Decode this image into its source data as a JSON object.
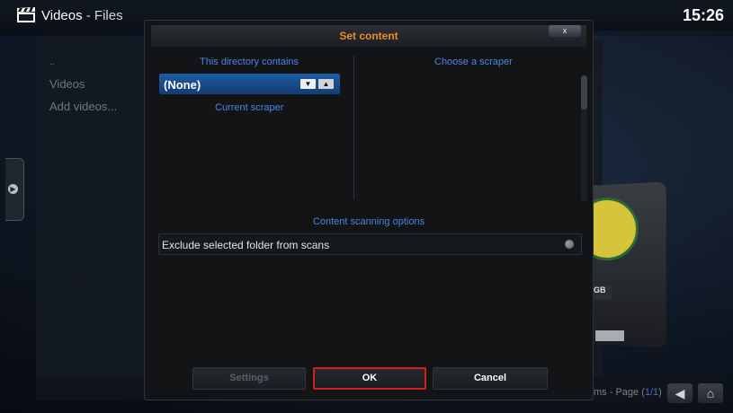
{
  "header": {
    "title": "Videos",
    "subtitle": "- Files",
    "clock": "15:26"
  },
  "background_list": {
    "items": [
      "..",
      "Videos",
      "Add videos..."
    ]
  },
  "footer": {
    "items_prefix": "ms - Page (",
    "page_number": "1/1",
    "items_suffix": ")"
  },
  "drive": {
    "label": "GB"
  },
  "dialog": {
    "title": "Set content",
    "close_label": "x",
    "left_column_heading": "This directory contains",
    "right_column_heading": "Choose a scraper",
    "content_type_value": "(None)",
    "current_scraper_label": "Current scraper",
    "scanning_section_label": "Content scanning options",
    "exclude_option_label": "Exclude selected folder from scans",
    "buttons": {
      "settings": "Settings",
      "ok": "OK",
      "cancel": "Cancel"
    }
  },
  "colors": {
    "accent_blue": "#4a86e0",
    "title_orange": "#e88d2a",
    "focus_red": "#d21f1f",
    "selected_blue": "#1e5ca3"
  }
}
